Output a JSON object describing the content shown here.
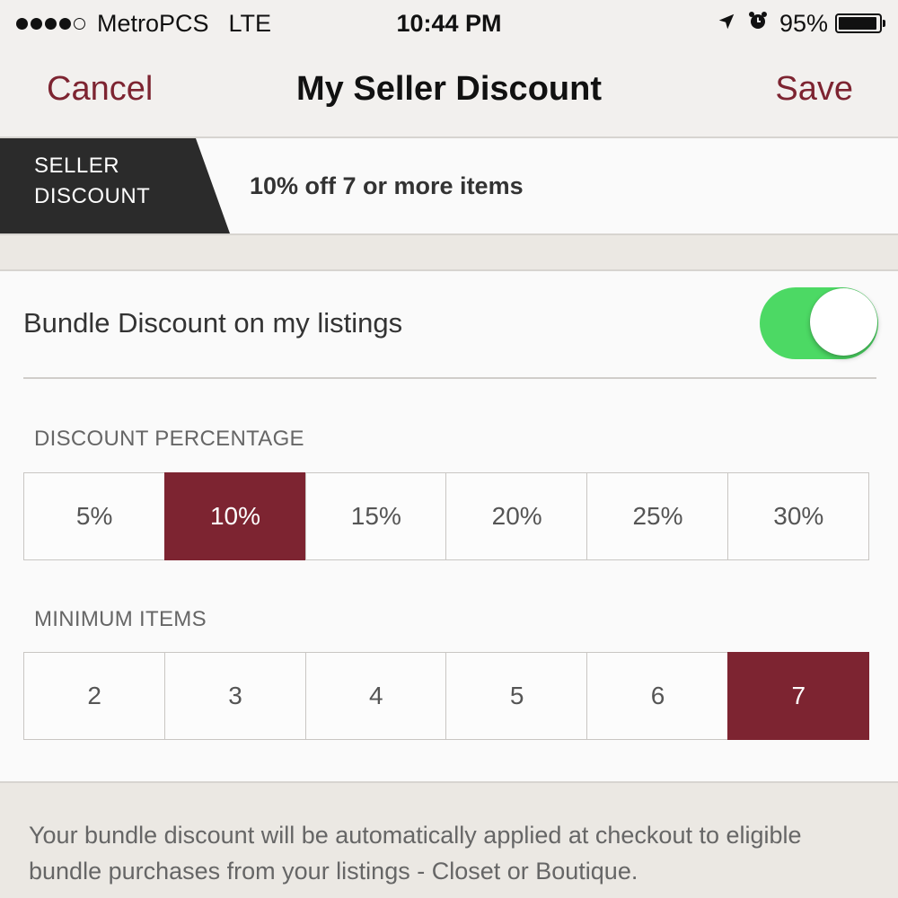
{
  "status_bar": {
    "carrier": "MetroPCS",
    "network": "LTE",
    "time": "10:44 PM",
    "battery_percent": "95%",
    "battery_level": 0.95,
    "signal_bars_filled": 4,
    "signal_bars_total": 5,
    "icons": [
      "location-arrow-icon",
      "alarm-clock-icon"
    ]
  },
  "nav": {
    "cancel_label": "Cancel",
    "title": "My Seller Discount",
    "save_label": "Save"
  },
  "banner": {
    "tag_line1": "SELLER",
    "tag_line2": "DISCOUNT",
    "summary": "10% off 7 or more items"
  },
  "settings": {
    "toggle_label": "Bundle Discount on my listings",
    "toggle_on": true,
    "discount_section_label": "DISCOUNT PERCENTAGE",
    "discount_options": [
      "5%",
      "10%",
      "15%",
      "20%",
      "25%",
      "30%"
    ],
    "discount_selected_index": 1,
    "minimum_section_label": "MINIMUM ITEMS",
    "minimum_options": [
      "2",
      "3",
      "4",
      "5",
      "6",
      "7"
    ],
    "minimum_selected_index": 5
  },
  "footer": {
    "note": "Your bundle discount will be automatically applied at checkout to eligible bundle purchases from your listings - Closet or Boutique."
  },
  "colors": {
    "accent": "#7d2431",
    "toggle_on": "#4cd964",
    "banner_tag": "#2b2b2b",
    "page_background": "#ebe8e3"
  }
}
